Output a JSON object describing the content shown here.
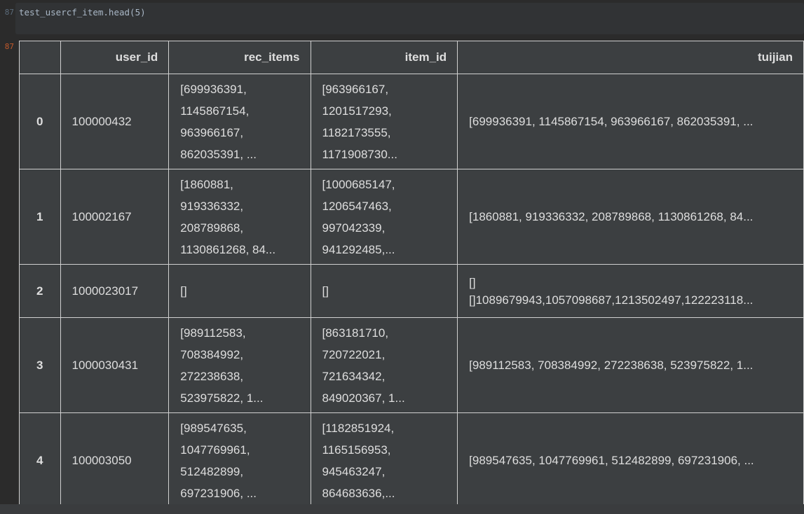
{
  "notebook": {
    "input_prompt": "87",
    "output_prompt": "87",
    "code": "test_usercf_item.head(5)"
  },
  "table": {
    "headers": [
      "",
      "user_id",
      "rec_items",
      "item_id",
      "tuijian"
    ],
    "rows": [
      {
        "index": "0",
        "user_id": "100000432",
        "rec_items": "[699936391,\n1145867154,\n963966167,\n862035391, ...",
        "item_id": "[963966167,\n1201517293,\n1182173555,\n1171908730...",
        "tuijian": "[699936391, 1145867154, 963966167, 862035391, ..."
      },
      {
        "index": "1",
        "user_id": "100002167",
        "rec_items": "[1860881,\n919336332,\n208789868,\n1130861268, 84...",
        "item_id": "[1000685147,\n1206547463,\n997042339,\n941292485,...",
        "tuijian": "[1860881, 919336332, 208789868, 1130861268, 84..."
      },
      {
        "index": "2",
        "user_id": "1000023017",
        "rec_items": "[]",
        "item_id": "[]",
        "tuijian": "[]\n[]1089679943,1057098687,1213502497,122223118..."
      },
      {
        "index": "3",
        "user_id": "1000030431",
        "rec_items": "[989112583,\n708384992,\n272238638,\n523975822, 1...",
        "item_id": "[863181710,\n720722021,\n721634342,\n849020367, 1...",
        "tuijian": "[989112583, 708384992, 272238638, 523975822, 1..."
      },
      {
        "index": "4",
        "user_id": "100003050",
        "rec_items": "[989547635,\n1047769961,\n512482899,\n697231906, ...",
        "item_id": "[1182851924,\n1165156953,\n945463247,\n864683636,...",
        "tuijian": "[989547635, 1047769961, 512482899, 697231906, ..."
      }
    ]
  }
}
